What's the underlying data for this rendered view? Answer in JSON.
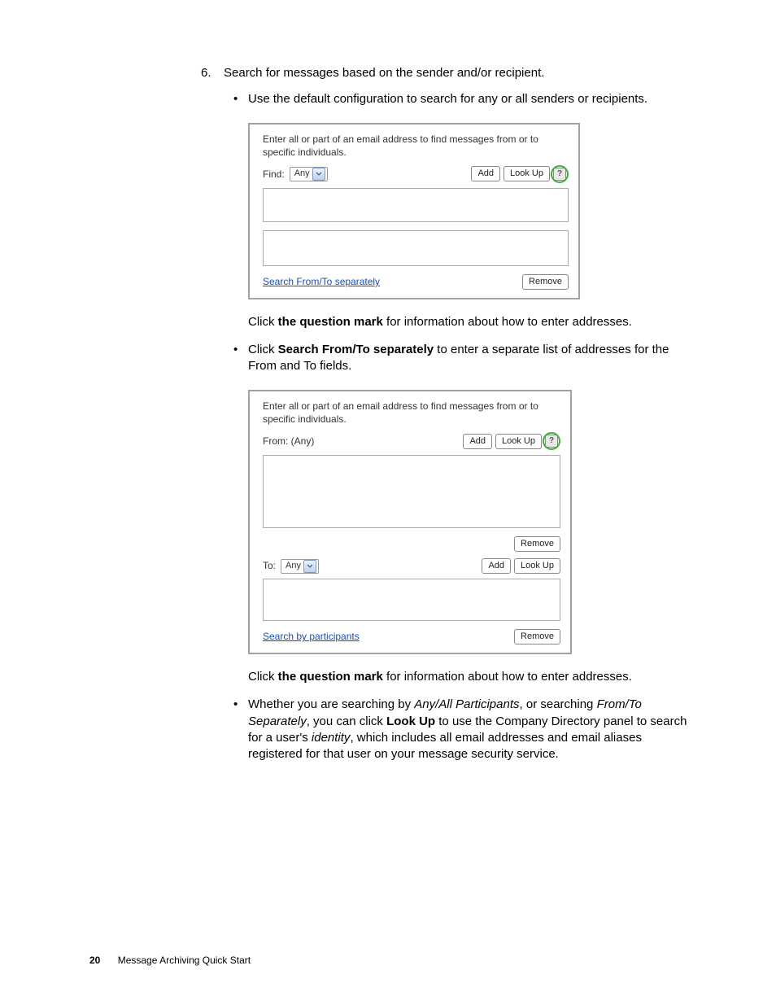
{
  "step": {
    "number": "6.",
    "text": "Search for messages based on the sender and/or recipient."
  },
  "bullet1": "Use the default configuration to search for any or all senders or recipients.",
  "panel1": {
    "intro": "Enter all or part of an email address to find messages from or to specific individuals.",
    "find_label": "Find:",
    "dd_value": "Any",
    "add": "Add",
    "lookup": "Look Up",
    "link": "Search From/To separately",
    "remove": "Remove"
  },
  "after1_pre": "Click ",
  "after1_bold": "the question mark",
  "after1_post": " for information about how to enter addresses.",
  "bullet2_pre": "Click ",
  "bullet2_bold": "Search From/To separately",
  "bullet2_post": " to enter a separate list of addresses for the From and To fields.",
  "panel2": {
    "intro": "Enter all or part of an email address to find messages from or to specific individuals.",
    "from_label": "From: (Any)",
    "add": "Add",
    "lookup": "Look Up",
    "remove1": "Remove",
    "to_label": "To:",
    "dd_value": "Any",
    "remove2": "Remove",
    "link": "Search by participants"
  },
  "after2_pre": "Click ",
  "after2_bold": "the question mark",
  "after2_post": " for information about how to enter addresses.",
  "bullet3_a": "Whether you are searching by ",
  "bullet3_i1": "Any/All Participants",
  "bullet3_b": ", or searching ",
  "bullet3_i2": "From/To Separately",
  "bullet3_c": ", you can click ",
  "bullet3_bold": "Look Up",
  "bullet3_d": " to use the Company Directory panel to search for a user's ",
  "bullet3_i3": "identity",
  "bullet3_e": ", which includes all email addresses and email aliases registered for that user on your message security service.",
  "footer": {
    "page": "20",
    "title": "Message Archiving Quick Start"
  },
  "help_glyph": "?"
}
